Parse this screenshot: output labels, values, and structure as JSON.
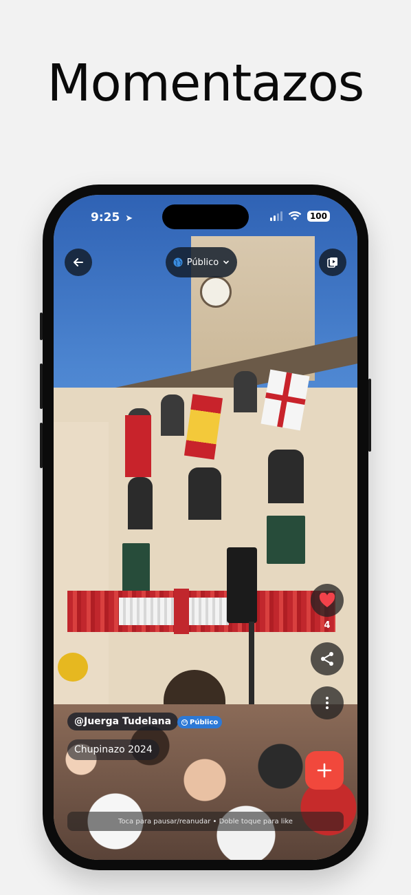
{
  "headline": "Momentazos",
  "status_bar": {
    "time": "9:25",
    "battery": "100"
  },
  "top_bar": {
    "back_icon": "arrow-left-icon",
    "privacy_label": "Público",
    "privacy_icon": "globe-icon",
    "reels_icon": "video-library-icon"
  },
  "actions": {
    "like_icon": "heart-icon",
    "like_count": "4",
    "share_icon": "share-icon",
    "more_icon": "more-vertical-icon",
    "add_icon": "plus-icon"
  },
  "post": {
    "username": "@Juerga Tudelana",
    "visibility_badge": "Público",
    "caption": "Chupinazo 2024"
  },
  "hint": "Toca para pausar/reanudar • Doble toque para like",
  "colors": {
    "accent": "#f1483c",
    "badge": "#2d79d6",
    "like": "#f3424a"
  }
}
